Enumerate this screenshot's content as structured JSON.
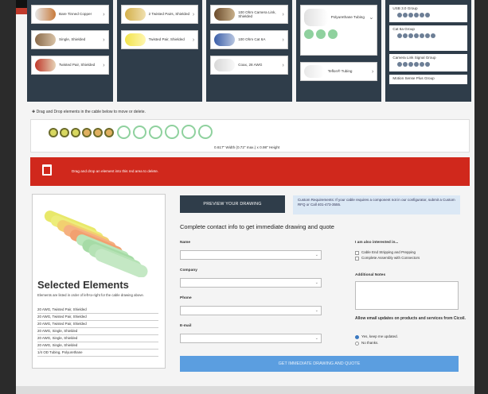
{
  "palette": {
    "col1": [
      "Bare Tinned Copper",
      "Single, Shielded",
      "Twisted Pair, Shielded"
    ],
    "col2": [
      "2 Twisted Pairs, Shielded",
      "Twisted Pair, Shielded"
    ],
    "col3": [
      "100 Ohm Camera Link, Shielded",
      "100 Ohm Cat 6A",
      "Coax, 28 AWG"
    ],
    "col4": [
      "Polyurethane Tubing",
      "Teflon® Tubing"
    ],
    "col5": [
      "USB 3.0 Group",
      "Cat 6a Group",
      "Camera Link Signal Group",
      "Motion Sense Plus Group"
    ]
  },
  "drag_hint": "Drag and Drop elements in the cable below to move or delete.",
  "dimensions": "0.617\" Width (0.72\" max.) x 0.98\" Height",
  "trash_text": "Drag and drop an element into this red area to delete.",
  "selected": {
    "title": "Selected Elements",
    "description": "Elements are listed in order of left-to-right for the cable drawing above.",
    "items": [
      "20 AWG, Twisted Pair, Shielded",
      "20 AWG, Twisted Pair, Shielded",
      "20 AWG, Twisted Pair, Shielded",
      "20 AWG, Single, Shielded",
      "20 AWG, Single, Shielded",
      "20 AWG, Single, Shielded",
      "1/4 OD Tubing, Polyurethane"
    ]
  },
  "preview_button": "PREVIEW YOUR DRAWING",
  "custom_requirements": "Custom Requirements: If your cable requires a component not in our configurator, submit a Custom RFQ or Call 401-473-3555.",
  "form": {
    "title": "Complete contact info to get immediate drawing and quote",
    "name_label": "Name",
    "company_label": "Company",
    "phone_label": "Phone",
    "email_label": "E-mail",
    "interest_title": "I am also interested in...",
    "interest_1": "Cable End Stripping and Prepping",
    "interest_2": "Complete Assembly with Connectors",
    "notes_label": "Additional Notes",
    "email_updates_title": "Allow email updates on products and services from Cicoil.",
    "radio_yes": "Yes, keep me updated.",
    "radio_no": "No thanks.",
    "submit": "GET IMMEDIATE DRAWING AND QUOTE"
  },
  "colors": {
    "dark_panel": "#2f3d4a",
    "trash_red": "#d0281c",
    "submit_blue": "#5b9ee0"
  }
}
